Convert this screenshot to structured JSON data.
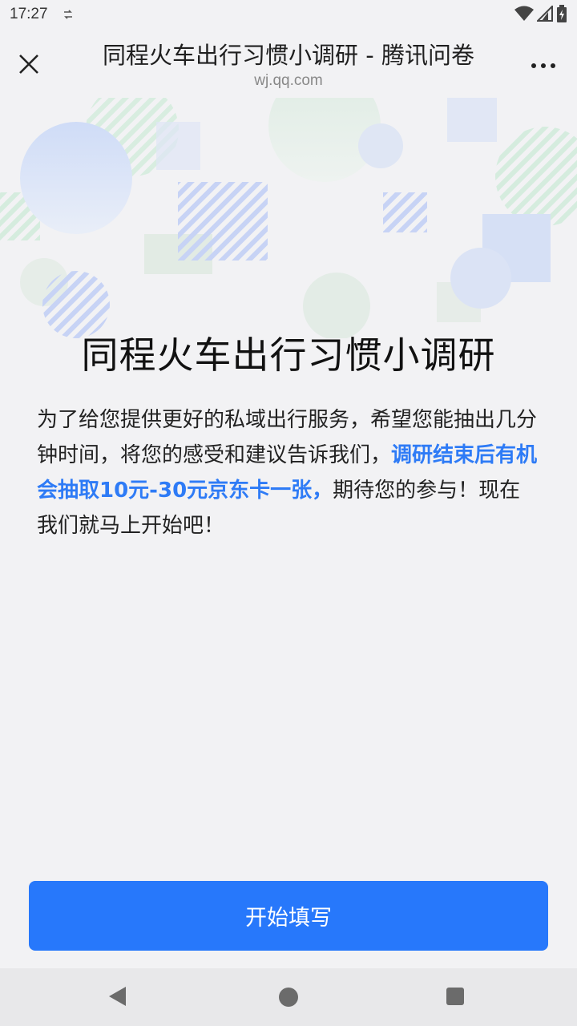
{
  "status": {
    "time": "17:27"
  },
  "titlebar": {
    "title": "同程火车出行习惯小调研 - 腾讯问卷",
    "url": "wj.qq.com"
  },
  "survey": {
    "title": "同程火车出行习惯小调研",
    "desc_part1": "为了给您提供更好的私域出行服务，希望您能抽出几分钟时间，将您的感受和建议告诉我们，",
    "desc_highlight": "调研结束后有机会抽取10元-30元京东卡一张，",
    "desc_part2": "期待您的参与！现在我们就马上开始吧！"
  },
  "actions": {
    "start_label": "开始填写"
  },
  "colors": {
    "accent": "#2778fb",
    "highlight_text": "#2e7bf6"
  }
}
